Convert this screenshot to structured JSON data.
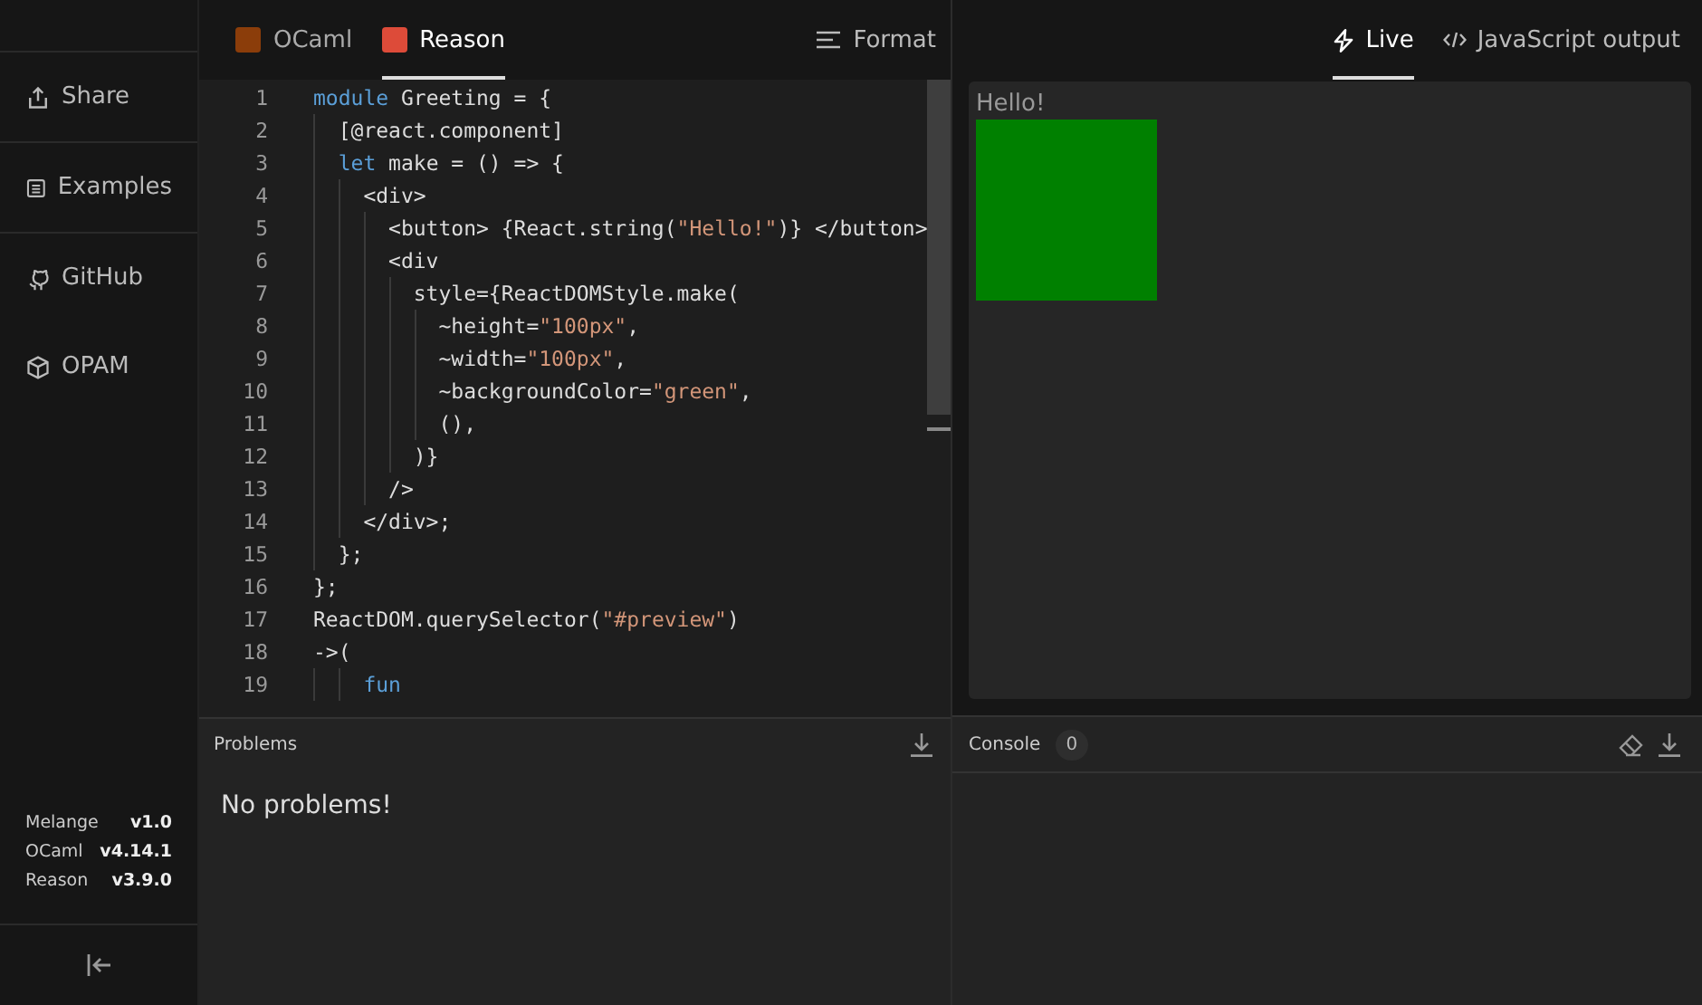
{
  "sidebar": {
    "items": [
      {
        "label": "Share"
      },
      {
        "label": "Examples"
      },
      {
        "label": "GitHub"
      },
      {
        "label": "OPAM"
      }
    ],
    "versions": [
      {
        "name": "Melange",
        "version": "v1.0"
      },
      {
        "name": "OCaml",
        "version": "v4.14.1"
      },
      {
        "name": "Reason",
        "version": "v3.9.0"
      }
    ]
  },
  "editor": {
    "languages": [
      {
        "label": "OCaml",
        "color": "#8b3d0a",
        "selected": false
      },
      {
        "label": "Reason",
        "color": "#dd4b39",
        "selected": true
      }
    ],
    "format_button": "Format",
    "lines": [
      {
        "number": "1",
        "tokens": [
          {
            "kind": "keyword",
            "text": "module"
          },
          {
            "kind": "plain",
            "text": " Greeting = {"
          }
        ]
      },
      {
        "number": "2",
        "tokens": [
          {
            "kind": "plain",
            "text": "  [@react.component]"
          }
        ]
      },
      {
        "number": "3",
        "tokens": [
          {
            "kind": "keyword",
            "text": "  let"
          },
          {
            "kind": "plain",
            "text": " make = () => {"
          }
        ]
      },
      {
        "number": "4",
        "tokens": [
          {
            "kind": "plain",
            "text": "    <div>"
          }
        ]
      },
      {
        "number": "5",
        "tokens": [
          {
            "kind": "plain",
            "text": "      <button> {React.string("
          },
          {
            "kind": "string",
            "text": "\"Hello!\""
          },
          {
            "kind": "plain",
            "text": ")} </button>"
          }
        ]
      },
      {
        "number": "6",
        "tokens": [
          {
            "kind": "plain",
            "text": "      <div"
          }
        ]
      },
      {
        "number": "7",
        "tokens": [
          {
            "kind": "plain",
            "text": "        style={ReactDOMStyle.make("
          }
        ]
      },
      {
        "number": "8",
        "tokens": [
          {
            "kind": "plain",
            "text": "          ~height="
          },
          {
            "kind": "string",
            "text": "\"100px\""
          },
          {
            "kind": "plain",
            "text": ","
          }
        ]
      },
      {
        "number": "9",
        "tokens": [
          {
            "kind": "plain",
            "text": "          ~width="
          },
          {
            "kind": "string",
            "text": "\"100px\""
          },
          {
            "kind": "plain",
            "text": ","
          }
        ]
      },
      {
        "number": "10",
        "tokens": [
          {
            "kind": "plain",
            "text": "          ~backgroundColor="
          },
          {
            "kind": "string",
            "text": "\"green\""
          },
          {
            "kind": "plain",
            "text": ","
          }
        ]
      },
      {
        "number": "11",
        "tokens": [
          {
            "kind": "plain",
            "text": "          (),"
          }
        ]
      },
      {
        "number": "12",
        "tokens": [
          {
            "kind": "plain",
            "text": "        )}"
          }
        ]
      },
      {
        "number": "13",
        "tokens": [
          {
            "kind": "plain",
            "text": "      />"
          }
        ]
      },
      {
        "number": "14",
        "tokens": [
          {
            "kind": "plain",
            "text": "    </div>;"
          }
        ]
      },
      {
        "number": "15",
        "tokens": [
          {
            "kind": "plain",
            "text": "  };"
          }
        ]
      },
      {
        "number": "16",
        "tokens": [
          {
            "kind": "plain",
            "text": "};"
          }
        ]
      },
      {
        "number": "17",
        "tokens": [
          {
            "kind": "plain",
            "text": "ReactDOM.querySelector("
          },
          {
            "kind": "string",
            "text": "\"#preview\""
          },
          {
            "kind": "plain",
            "text": ")"
          }
        ]
      },
      {
        "number": "18",
        "tokens": [
          {
            "kind": "plain",
            "text": "->("
          }
        ]
      },
      {
        "number": "19",
        "tokens": [
          {
            "kind": "keyword",
            "text": "    fun"
          }
        ]
      }
    ]
  },
  "problems": {
    "title": "Problems",
    "message": "No problems!"
  },
  "output": {
    "tabs": [
      {
        "label": "Live",
        "selected": true
      },
      {
        "label": "JavaScript output",
        "selected": false
      }
    ],
    "preview": {
      "button": "Hello!"
    }
  },
  "console": {
    "title": "Console",
    "count": "0"
  }
}
